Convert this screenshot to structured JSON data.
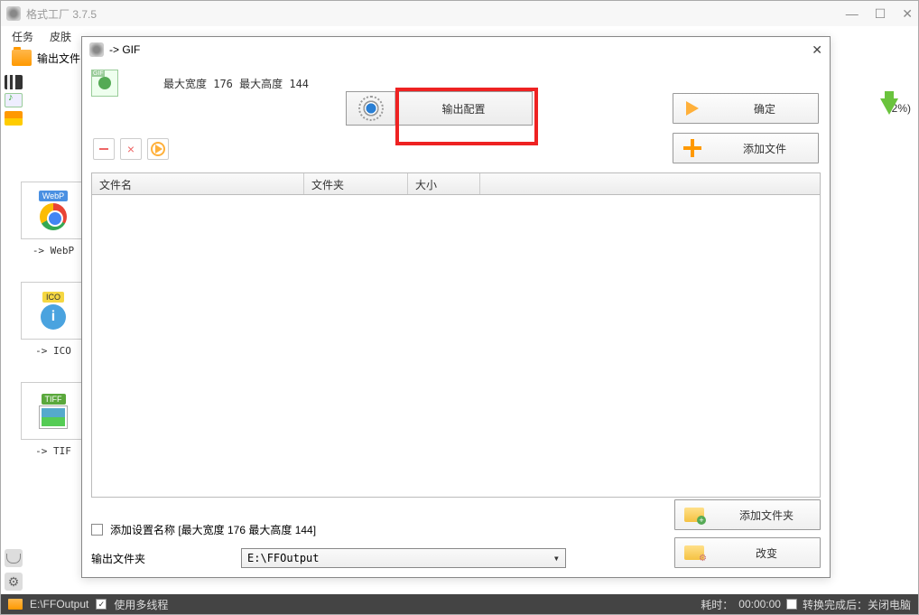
{
  "main": {
    "title": "格式工厂 3.7.5",
    "menu": {
      "task": "任务",
      "skin": "皮肤"
    },
    "toolbar_label": "输出文件",
    "right_percent": "2%)"
  },
  "thumbs": [
    {
      "tag": "WebP",
      "label": "-> WebP"
    },
    {
      "tag": "ICO",
      "label": "-> ICO"
    },
    {
      "tag": "TIFF",
      "label": "-> TIF"
    }
  ],
  "dialog": {
    "title": " -> GIF",
    "dim_text": "最大宽度 176 最大高度 144",
    "output_config": "输出配置",
    "ok": "确定",
    "add_file": "添加文件",
    "columns": {
      "c1": "文件名",
      "c2": "文件夹",
      "c3": "大小"
    },
    "add_setting_label": "添加设置名称 [最大宽度 176 最大高度 144]",
    "output_folder_label": "输出文件夹",
    "output_folder_value": "E:\\FFOutput",
    "add_folder": "添加文件夹",
    "change": "改变"
  },
  "statusbar": {
    "path": "E:\\FFOutput",
    "multithread": "使用多线程",
    "elapsed_label": "耗时：",
    "elapsed_value": "00:00:00",
    "shutdown": "转换完成后：关闭电脑"
  }
}
